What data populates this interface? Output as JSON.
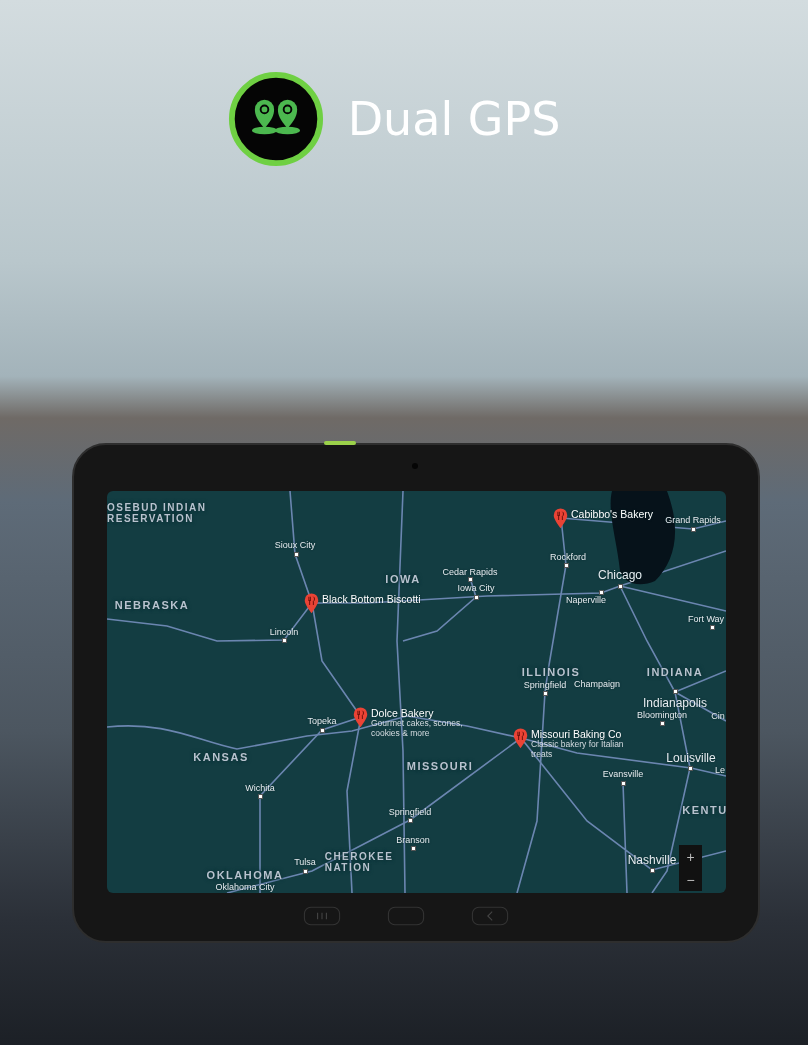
{
  "header": {
    "title": "Dual GPS"
  },
  "map": {
    "places": [
      {
        "kind": "region",
        "text": "OSEBUD INDIAN RESERVATION"
      },
      {
        "kind": "pin",
        "text": "Cabibbo's Bakery"
      },
      {
        "kind": "town",
        "text": "Grand Rapids"
      },
      {
        "kind": "town",
        "text": "Sioux City"
      },
      {
        "kind": "town",
        "text": "Rockford"
      },
      {
        "kind": "region",
        "text": "IOWA"
      },
      {
        "kind": "town",
        "text": "Cedar Rapids"
      },
      {
        "kind": "town",
        "text": "Chicago"
      },
      {
        "kind": "town",
        "text": "Iowa City"
      },
      {
        "kind": "pin",
        "text": "Black Bottom Biscotti"
      },
      {
        "kind": "town",
        "text": "Naperville"
      },
      {
        "kind": "region",
        "text": "NEBRASKA"
      },
      {
        "kind": "town",
        "text": "Fort Way"
      },
      {
        "kind": "town",
        "text": "Lincoln"
      },
      {
        "kind": "region",
        "text": "ILLINOIS"
      },
      {
        "kind": "region",
        "text": "INDIANA"
      },
      {
        "kind": "town",
        "text": "Springfield"
      },
      {
        "kind": "place",
        "text": "Champaign"
      },
      {
        "kind": "town",
        "text": "Indianapolis"
      },
      {
        "kind": "pin",
        "text": "Dolce Bakery",
        "note": "Gourmet cakes, scones, cookies & more"
      },
      {
        "kind": "town",
        "text": "Bloomington"
      },
      {
        "kind": "place",
        "text": "Cin"
      },
      {
        "kind": "town",
        "text": "Topeka"
      },
      {
        "kind": "pin",
        "text": "Missouri Baking Co",
        "note": "Classic bakery for Italian treats"
      },
      {
        "kind": "region",
        "text": "KANSAS"
      },
      {
        "kind": "town",
        "text": "Louisville"
      },
      {
        "kind": "place",
        "text": "Le"
      },
      {
        "kind": "region",
        "text": "MISSOURI"
      },
      {
        "kind": "town",
        "text": "Evansville"
      },
      {
        "kind": "town",
        "text": "Wichita"
      },
      {
        "kind": "region",
        "text": "KENTU"
      },
      {
        "kind": "town",
        "text": "Springfield"
      },
      {
        "kind": "town",
        "text": "Branson"
      },
      {
        "kind": "town",
        "text": "Tulsa"
      },
      {
        "kind": "region",
        "text": "CHEROKEE NATION"
      },
      {
        "kind": "town",
        "text": "Nashville"
      },
      {
        "kind": "region",
        "text": "OKLAHOMA"
      },
      {
        "kind": "place",
        "text": "Oklahoma City"
      }
    ],
    "zoom": {
      "in": "+",
      "out": "−"
    }
  }
}
